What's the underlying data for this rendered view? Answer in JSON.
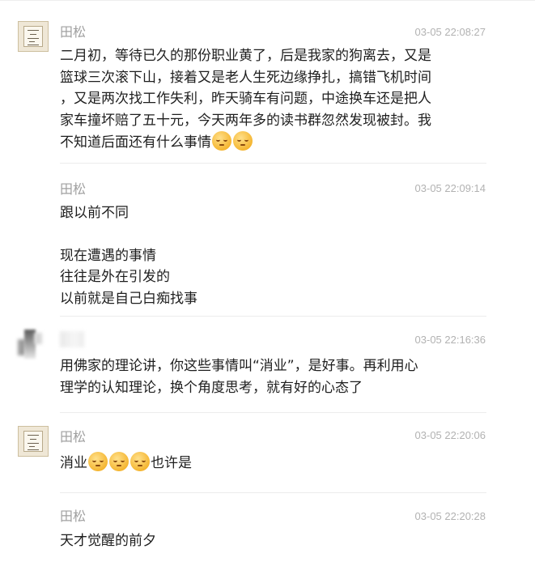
{
  "emoji_icon": "pensive-face-emoji",
  "messages": [
    {
      "author": "田松",
      "time": "03-05 22:08:27",
      "lines": [
        "二月初，等待已久的那份职业黄了，后是我家的狗离去，又是",
        "篮球三次滚下山，接着又是老人生死边缘挣扎，搞错飞机时间",
        "，又是两次找工作失利，昨天骑车有问题，中途换车还是把人",
        "家车撞坏赔了五十元，今天两年多的读书群忽然发现被封。我",
        "不知道后面还有什么事情"
      ]
    },
    {
      "author": "田松",
      "time": "03-05 22:09:14",
      "lines": [
        "跟以前不同",
        "",
        "现在遭遇的事情",
        "往往是外在引发的",
        "以前就是自己白痴找事"
      ]
    },
    {
      "author": "",
      "time": "03-05 22:16:36",
      "lines": [
        "用佛家的理论讲，你这些事情叫“消业”，是好事。再利用心",
        "理学的认知理论，换个角度思考，就有好的心态了"
      ]
    },
    {
      "author": "田松",
      "time": "03-05 22:20:06",
      "text_before": "消业",
      "text_after": "也许是"
    },
    {
      "author": "田松",
      "time": "03-05 22:20:28",
      "lines": [
        "天才觉醒的前夕"
      ]
    }
  ]
}
